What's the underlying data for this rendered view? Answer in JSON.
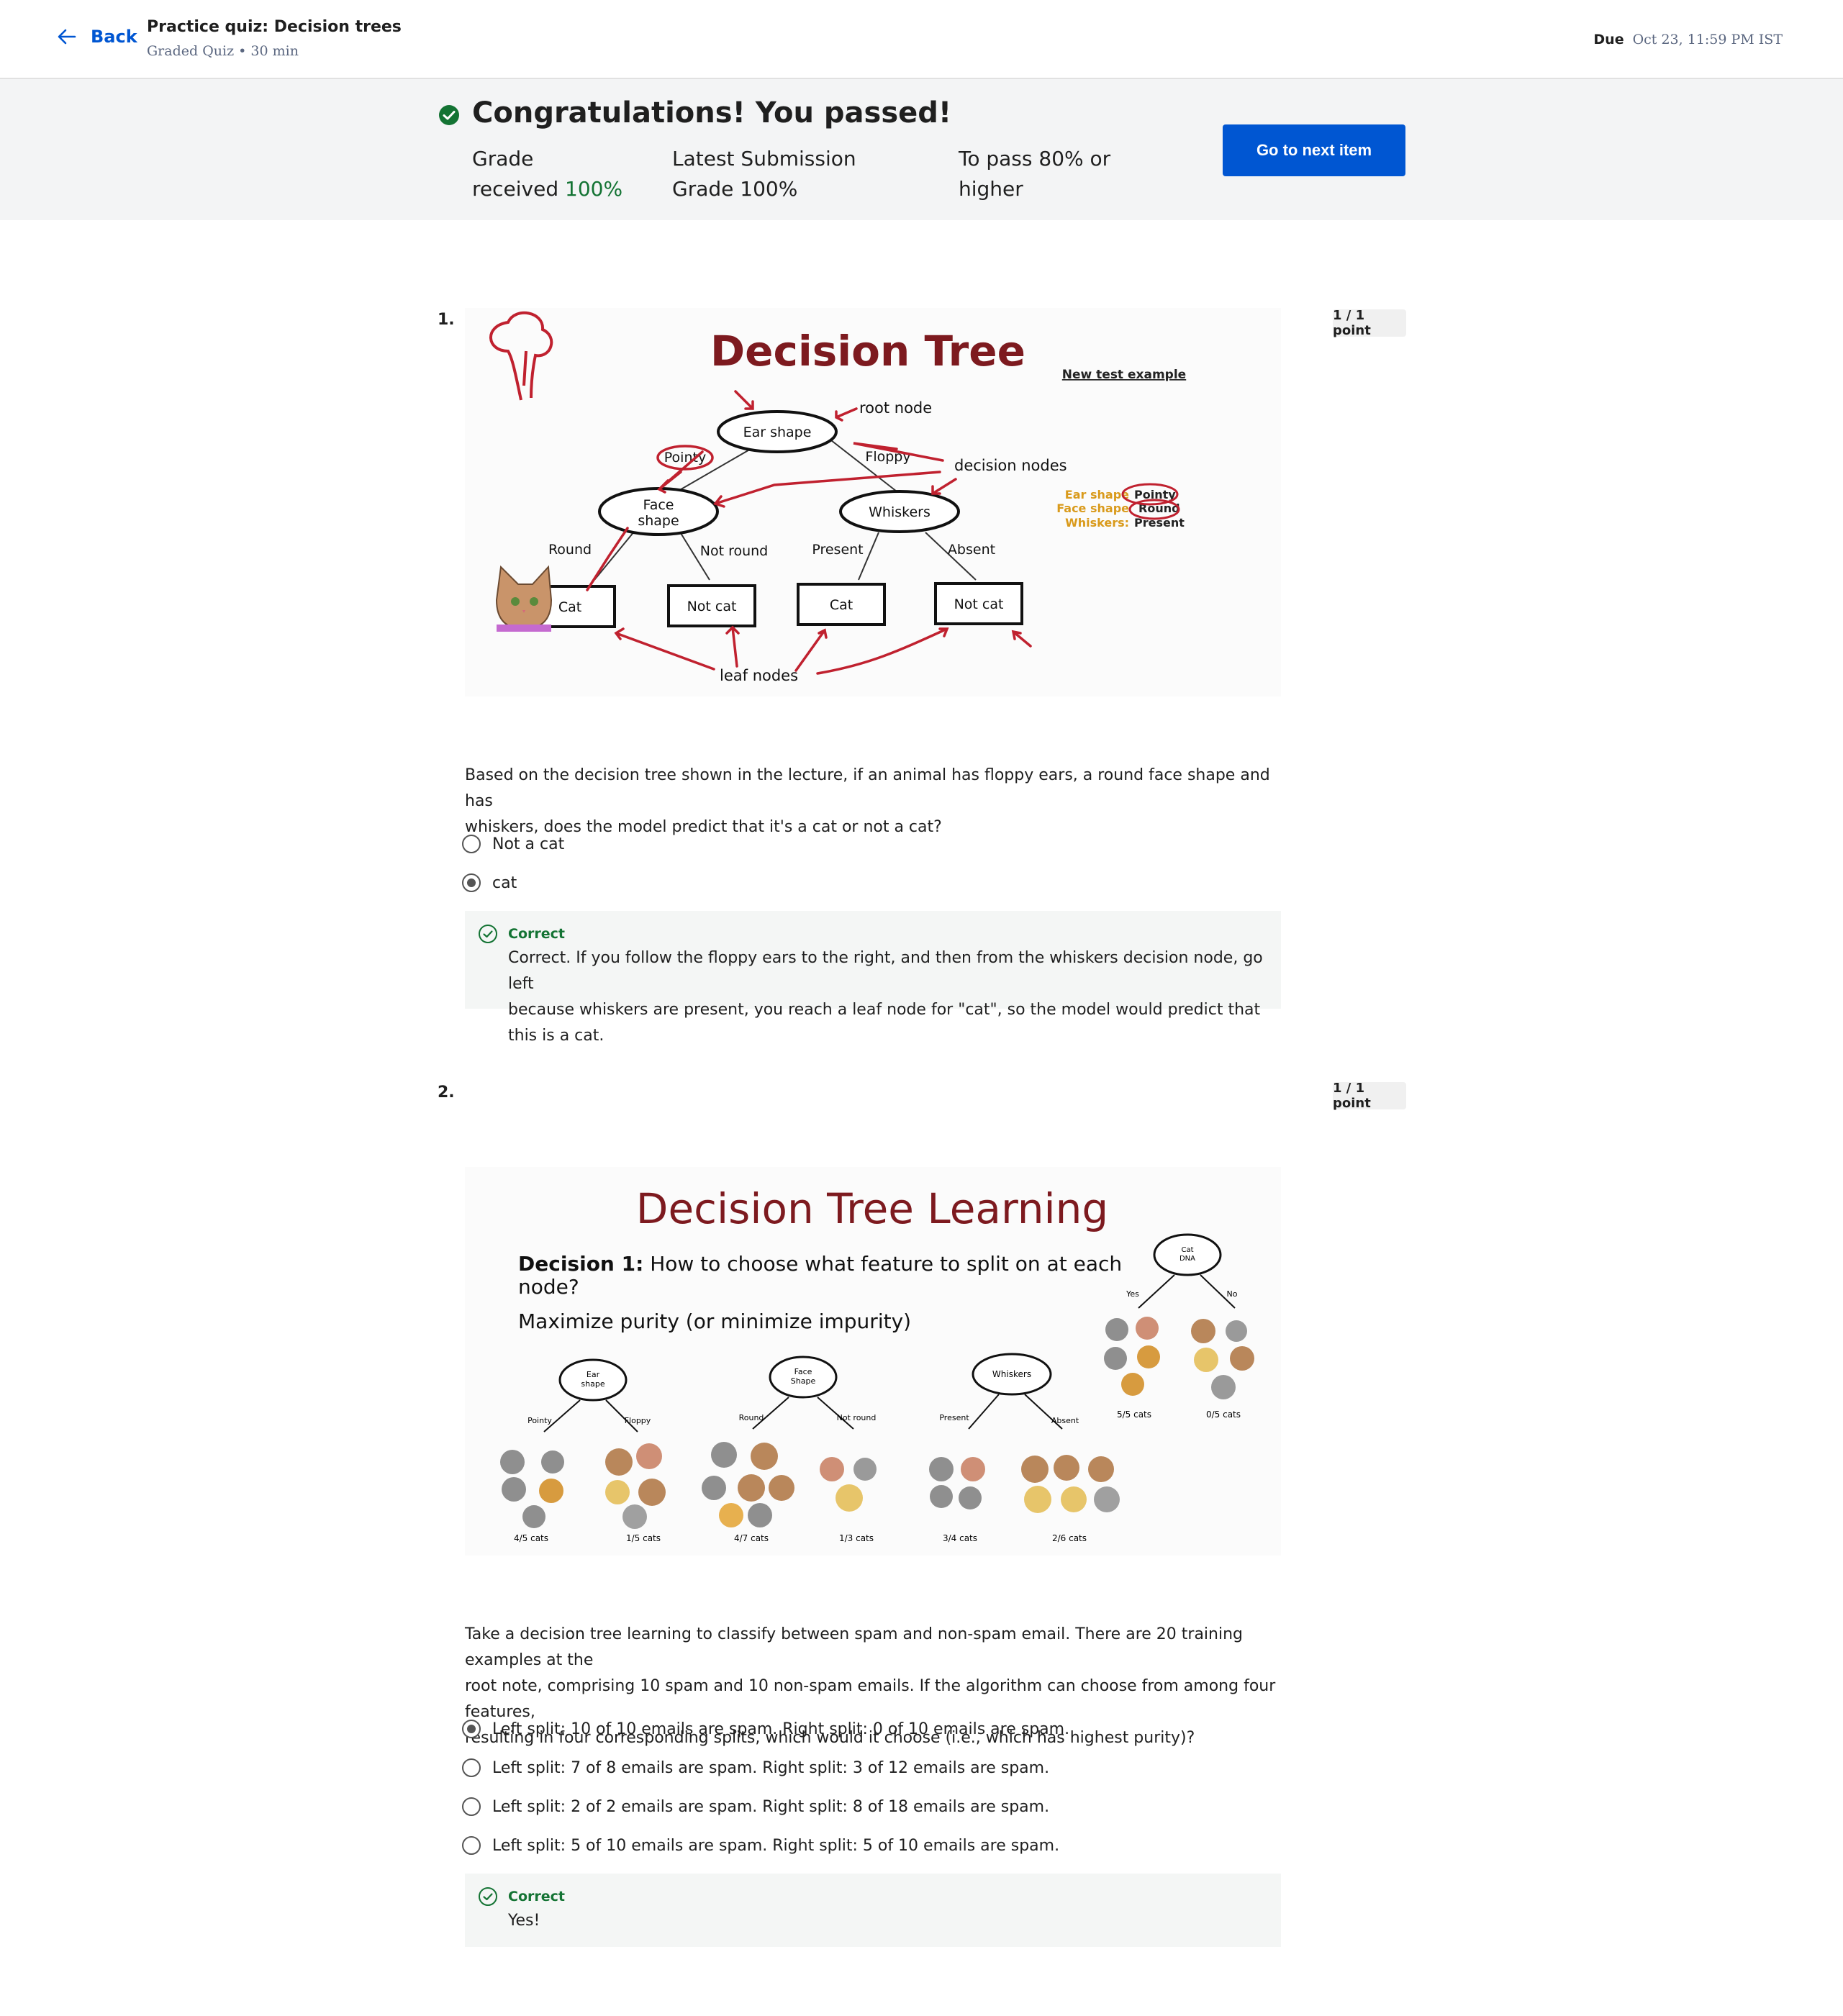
{
  "header": {
    "back_label": "Back",
    "title": "Practice quiz: Decision trees",
    "subtitle": "Graded Quiz • 30 min",
    "due_label": "Due",
    "due_value": "Oct 23, 11:59 PM IST"
  },
  "banner": {
    "message": "Congratulations! You passed!",
    "grade_label_1": "Grade",
    "grade_label_2": "received",
    "grade_value": "100%",
    "latest_label_1": "Latest Submission",
    "latest_label_2": "Grade",
    "latest_value": "100%",
    "pass_label": "To pass",
    "pass_value_1": "80% or",
    "pass_value_2": "higher",
    "next_button": "Go to next item"
  },
  "q1": {
    "number": "1.",
    "points": "1 / 1 point",
    "figure": {
      "title": "Decision Tree",
      "root_node": "root node",
      "decision_nodes": "decision nodes",
      "leaf_nodes": "leaf nodes",
      "ear_shape": "Ear shape",
      "face_shape_1": "Face",
      "face_shape_2": "shape",
      "whiskers": "Whiskers",
      "pointy": "Pointy",
      "floppy": "Floppy",
      "round": "Round",
      "not_round": "Not round",
      "present": "Present",
      "absent": "Absent",
      "leaf_1": "Cat",
      "leaf_2": "Not cat",
      "leaf_3": "Cat",
      "leaf_4": "Not cat",
      "new_example": "New test example",
      "ex_line1_a": "Ear shape",
      "ex_line1_b": "Pointy",
      "ex_line2_a": "Face shape",
      "ex_line2_b": "Round",
      "ex_line3_a": "Whiskers:",
      "ex_line3_b": "Present"
    },
    "prompt_1": "Based on the decision tree shown in the lecture, if an animal has floppy ears, a round face shape and has",
    "prompt_2": "whiskers, does the model predict that it's a cat or not a cat?",
    "options": [
      "Not a cat",
      "cat"
    ],
    "selected_index": 1,
    "feedback_head": "Correct",
    "feedback_1": "Correct. If you follow the floppy ears to the right, and then from the whiskers decision node, go left",
    "feedback_2": "because whiskers are present, you reach a leaf node for \"cat\", so the model would predict that this is a cat."
  },
  "q2": {
    "number": "2.",
    "points": "1 / 1 point",
    "figure": {
      "title": "Decision Tree Learning",
      "decision_bold": "Decision 1:",
      "decision_rest": " How to choose what feature to split on at each",
      "decision_rest_2": "node?",
      "maximize": "Maximize purity (or minimize impurity)",
      "tree1_node_1": "Ear",
      "tree1_node_2": "shape",
      "tree1_left": "Pointy",
      "tree1_right": "Floppy",
      "tree1_left_count": "4/5 cats",
      "tree1_right_count": "1/5 cats",
      "tree2_node_1": "Face",
      "tree2_node_2": "Shape",
      "tree2_left": "Round",
      "tree2_right": "Not round",
      "tree2_left_count": "4/7 cats",
      "tree2_right_count": "1/3 cats",
      "tree3_node": "Whiskers",
      "tree3_left": "Present",
      "tree3_right": "Absent",
      "tree3_left_count": "3/4 cats",
      "tree3_right_count": "2/6 cats",
      "tree4_node_1": "Cat",
      "tree4_node_2": "DNA",
      "tree4_left": "Yes",
      "tree4_right": "No",
      "tree4_left_count": "5/5 cats",
      "tree4_right_count": "0/5 cats"
    },
    "prompt_1": "Take a decision tree learning to classify between spam and non-spam email. There are 20 training examples at the",
    "prompt_2": "root note, comprising 10 spam and 10 non-spam emails. If the algorithm can choose from among four features,",
    "prompt_3": "resulting in four corresponding splits, which would it choose (i.e., which has highest purity)?",
    "options": [
      "Left split: 10 of 10 emails are spam. Right split: 0 of 10 emails are spam.",
      "Left split: 7 of 8 emails are spam. Right split: 3 of 12 emails are spam.",
      "Left split: 2 of 2 emails are spam. Right split: 8 of 18 emails are spam.",
      "Left split: 5 of 10 emails are spam. Right split: 5 of 10 emails are spam."
    ],
    "selected_index": 0,
    "feedback_head": "Correct",
    "feedback_1": "Yes!"
  },
  "colors": {
    "brand_blue": "#0056d2",
    "success_green": "#137333",
    "banner_bg": "#f3f4f5",
    "slide_title_red": "#7d1a1f",
    "annotation_red": "#c0212f",
    "example_orange": "#d99a1b"
  },
  "icons": {
    "back": "arrow-left-icon",
    "pass": "check-circle-icon",
    "feedback": "check-circle-outline-icon"
  }
}
